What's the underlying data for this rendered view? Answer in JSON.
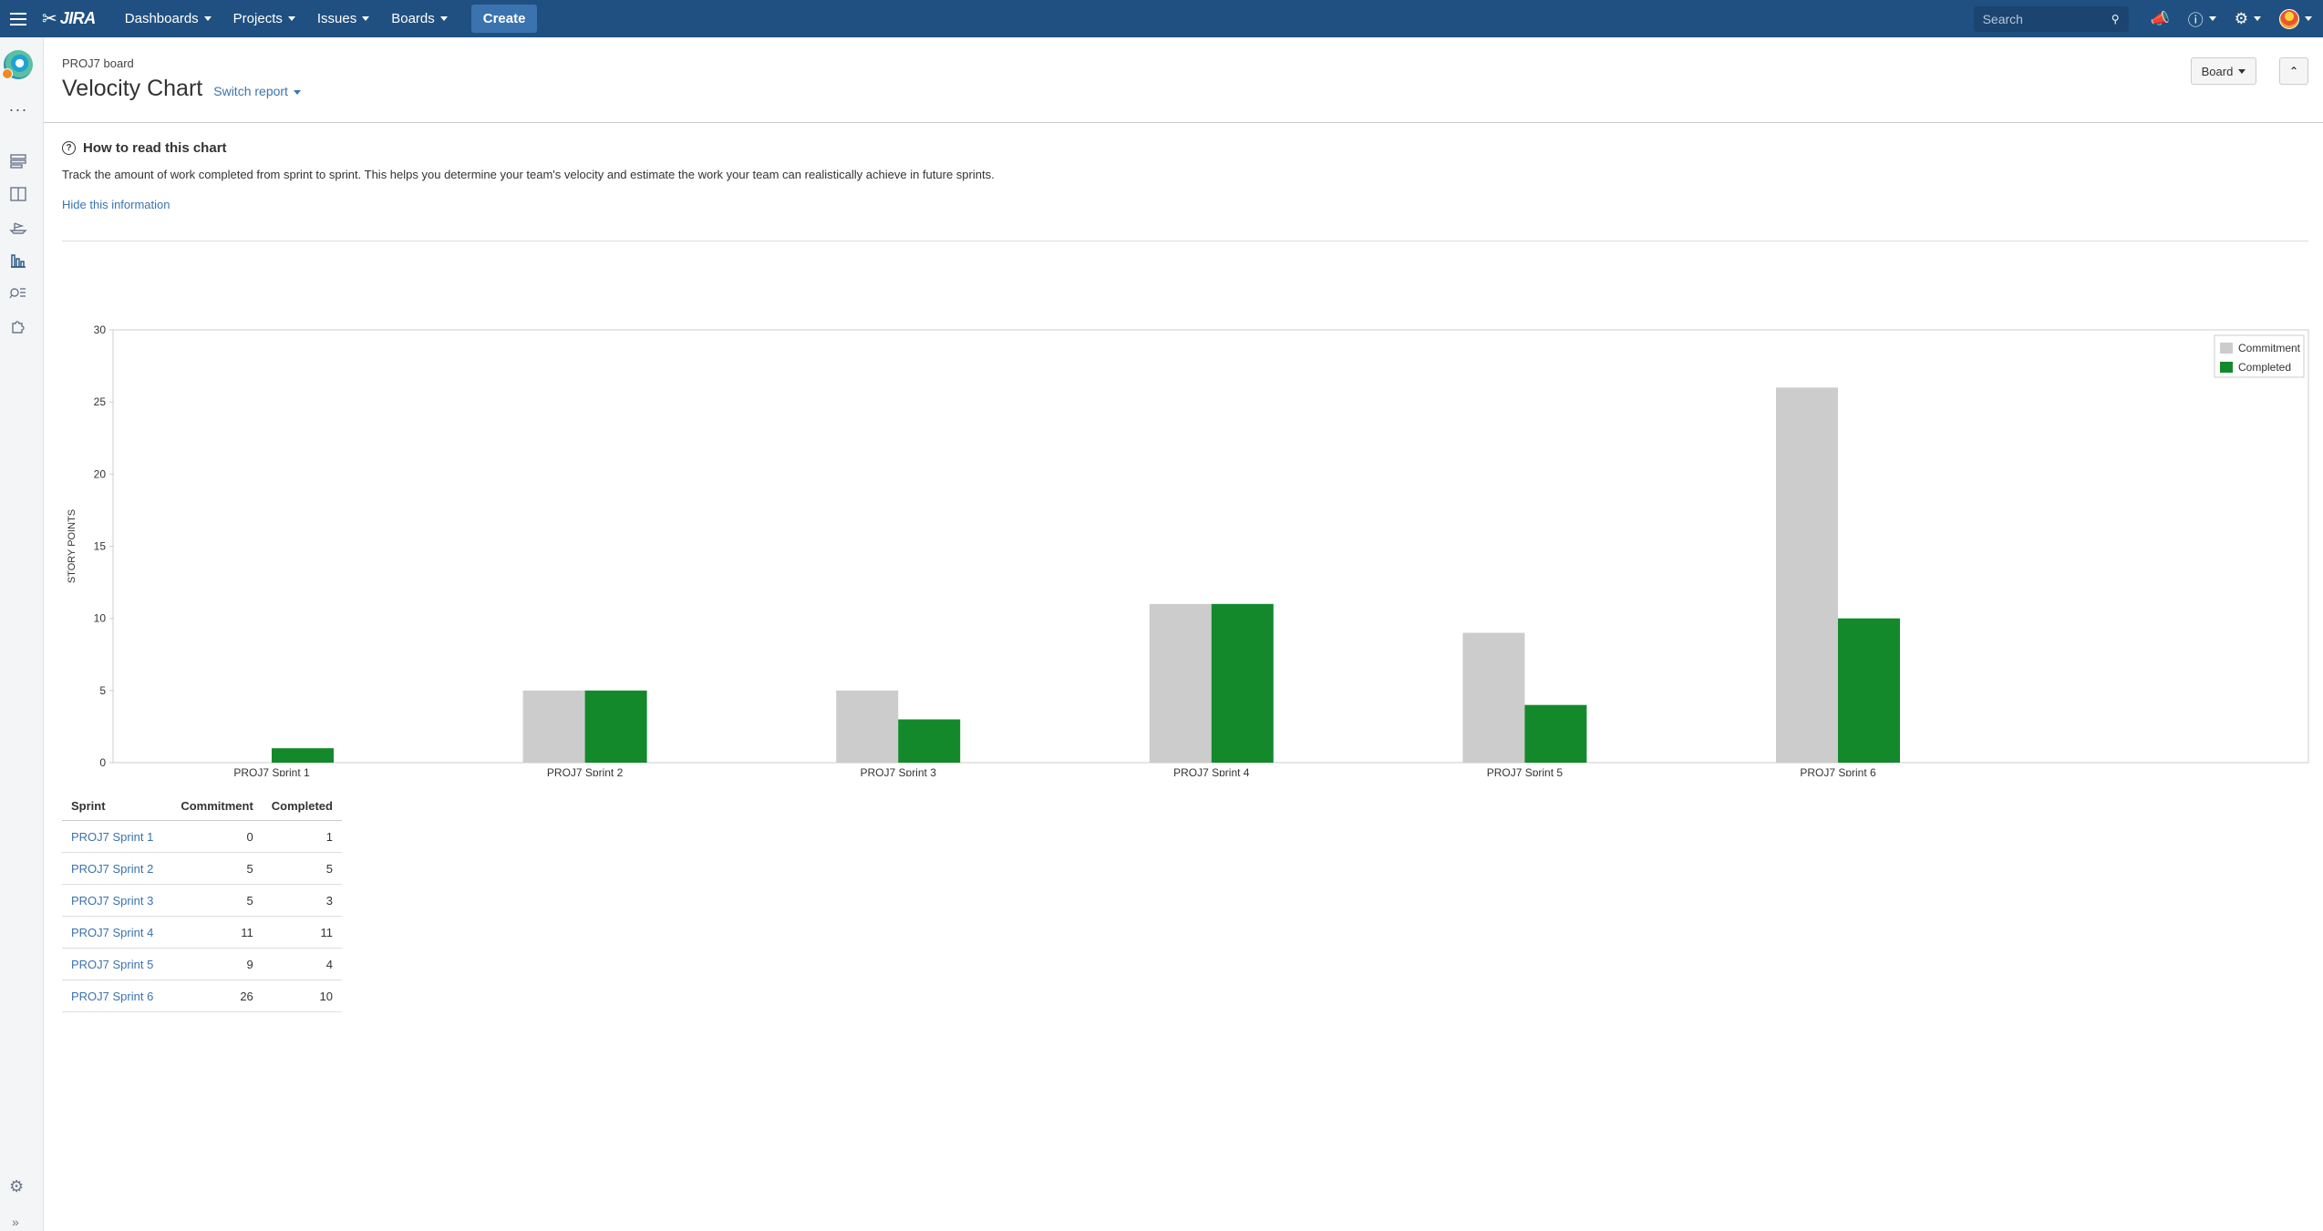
{
  "topnav": {
    "logo_text": "JIRA",
    "menus": [
      "Dashboards",
      "Projects",
      "Issues",
      "Boards"
    ],
    "create_label": "Create",
    "search_placeholder": "Search"
  },
  "page": {
    "breadcrumb": "PROJ7 board",
    "title": "Velocity Chart",
    "switch_report": "Switch report",
    "board_button": "Board"
  },
  "info": {
    "title": "How to read this chart",
    "description": "Track the amount of work completed from sprint to sprint. This helps you determine your team's velocity and estimate the work your team can realistically achieve in future sprints.",
    "hide_link": "Hide this information"
  },
  "chart_data": {
    "type": "bar",
    "categories": [
      "PROJ7 Sprint 1",
      "PROJ7 Sprint 2",
      "PROJ7 Sprint 3",
      "PROJ7 Sprint 4",
      "PROJ7 Sprint 5",
      "PROJ7 Sprint 6"
    ],
    "series": [
      {
        "name": "Commitment",
        "values": [
          0,
          5,
          5,
          11,
          9,
          26
        ],
        "color": "#cccccc"
      },
      {
        "name": "Completed",
        "values": [
          1,
          5,
          3,
          11,
          4,
          10
        ],
        "color": "#14892c"
      }
    ],
    "ylabel": "STORY POINTS",
    "ylim": [
      0,
      30
    ],
    "yticks": [
      0,
      5,
      10,
      15,
      20,
      25,
      30
    ],
    "legend": "top-right",
    "grid": false
  },
  "table": {
    "headers": [
      "Sprint",
      "Commitment",
      "Completed"
    ],
    "rows": [
      [
        "PROJ7 Sprint 1",
        "0",
        "1"
      ],
      [
        "PROJ7 Sprint 2",
        "5",
        "5"
      ],
      [
        "PROJ7 Sprint 3",
        "5",
        "3"
      ],
      [
        "PROJ7 Sprint 4",
        "11",
        "11"
      ],
      [
        "PROJ7 Sprint 5",
        "9",
        "4"
      ],
      [
        "PROJ7 Sprint 6",
        "26",
        "10"
      ]
    ]
  },
  "icons": {
    "sidebar": [
      "backlog-icon",
      "board-icon",
      "releases-icon",
      "reports-icon",
      "issues-search-icon",
      "addons-icon"
    ],
    "top_right": [
      "notifications-icon",
      "help-icon",
      "settings-gear-icon",
      "user-avatar"
    ]
  }
}
